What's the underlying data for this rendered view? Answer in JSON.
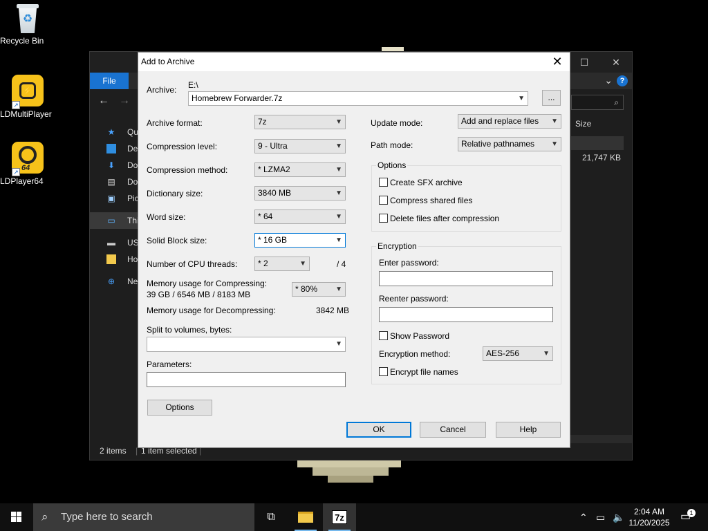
{
  "desktop": {
    "icons": [
      {
        "label": "Recycle Bin"
      },
      {
        "label": "LDMultiPlayer"
      },
      {
        "label": "LDPlayer64",
        "badge": "64"
      }
    ]
  },
  "explorer": {
    "ribbon_file": "File",
    "help_glyph": "?",
    "sidebar": [
      {
        "label": "Quick access"
      },
      {
        "label": "Desktop"
      },
      {
        "label": "Downloads"
      },
      {
        "label": "Documents"
      },
      {
        "label": "Pictures"
      },
      {
        "label": "This PC"
      },
      {
        "label": "USB Drive"
      },
      {
        "label": "Homebrew"
      },
      {
        "label": "Network"
      }
    ],
    "column_size": "Size",
    "file_size": "21,747 KB",
    "status_items": "2 items",
    "status_selected": "1 item selected"
  },
  "dialog": {
    "title": "Add to Archive",
    "archive_label": "Archive:",
    "archive_path": "E:\\",
    "archive_name": "Homebrew Forwarder.7z",
    "browse_label": "...",
    "left": {
      "archive_format_label": "Archive format:",
      "archive_format": "7z",
      "compression_level_label": "Compression level:",
      "compression_level": "9 - Ultra",
      "compression_method_label": "Compression method:",
      "compression_method": "* LZMA2",
      "dictionary_size_label": "Dictionary size:",
      "dictionary_size": "3840 MB",
      "word_size_label": "Word size:",
      "word_size": "* 64",
      "solid_block_label": "Solid Block size:",
      "solid_block": "* 16 GB",
      "cpu_threads_label": "Number of CPU threads:",
      "cpu_threads": "* 2",
      "cpu_threads_total": "/ 4",
      "mem_compress_label": "Memory usage for Compressing:",
      "mem_compress_value": "39 GB / 6546 MB / 8183 MB",
      "mem_compress_pct": "* 80%",
      "mem_decompress_label": "Memory usage for Decompressing:",
      "mem_decompress_value": "3842 MB",
      "split_label": "Split to volumes, bytes:",
      "split_value": "",
      "params_label": "Parameters:",
      "params_value": "",
      "options_button": "Options"
    },
    "right": {
      "update_mode_label": "Update mode:",
      "update_mode": "Add and replace files",
      "path_mode_label": "Path mode:",
      "path_mode": "Relative pathnames",
      "options_group": "Options",
      "create_sfx": "Create SFX archive",
      "compress_shared": "Compress shared files",
      "delete_after": "Delete files after compression",
      "encryption_group": "Encryption",
      "enter_password_label": "Enter password:",
      "reenter_password_label": "Reenter password:",
      "show_password": "Show Password",
      "encryption_method_label": "Encryption method:",
      "encryption_method": "AES-256",
      "encrypt_names": "Encrypt file names"
    },
    "buttons": {
      "ok": "OK",
      "cancel": "Cancel",
      "help": "Help"
    }
  },
  "taskbar": {
    "search_placeholder": "Type here to search",
    "app_7z": "7z",
    "time": "2:04 AM",
    "date": "11/20/2025",
    "notification_count": "1"
  }
}
